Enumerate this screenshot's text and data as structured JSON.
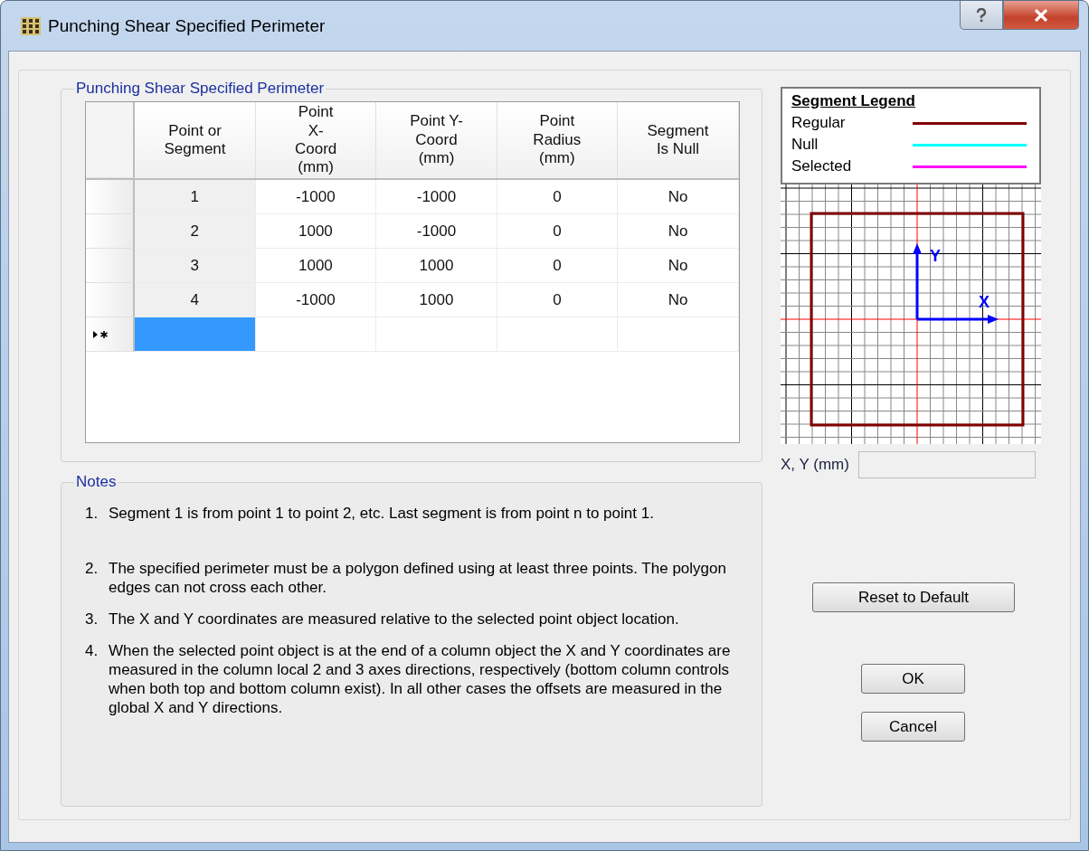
{
  "window": {
    "title": "Punching Shear Specified Perimeter"
  },
  "perimeter_group": {
    "title": "Punching Shear Specified Perimeter"
  },
  "table": {
    "columns": [
      "Point or Segment",
      "Point X-Coord (mm)",
      "Point Y-Coord (mm)",
      "Point Radius (mm)",
      "Segment Is Null"
    ],
    "rows": [
      {
        "cells": [
          "1",
          "-1000",
          "-1000",
          "0",
          "No"
        ]
      },
      {
        "cells": [
          "2",
          "1000",
          "-1000",
          "0",
          "No"
        ]
      },
      {
        "cells": [
          "3",
          "1000",
          "1000",
          "0",
          "No"
        ]
      },
      {
        "cells": [
          "4",
          "-1000",
          "1000",
          "0",
          "No"
        ]
      }
    ],
    "new_row": {
      "selected": true
    }
  },
  "legend": {
    "title": "Segment Legend",
    "items": [
      {
        "label": "Regular",
        "color": "#800000"
      },
      {
        "label": "Null",
        "color": "#00ffff"
      },
      {
        "label": "Selected",
        "color": "#ff00ff"
      }
    ]
  },
  "plot": {
    "axis_labels": [
      "X",
      "Y"
    ]
  },
  "coordinate_field": {
    "label": "X, Y (mm)"
  },
  "notes": {
    "title": "Notes",
    "items": [
      {
        "number": "1.",
        "text": "Segment 1 is from point 1 to point 2, etc.  Last segment is from point n to point 1."
      },
      {
        "number": "2.",
        "text": "The specified perimeter must be a polygon defined using at least three points. The polygon edges can not cross each other."
      },
      {
        "number": "3.",
        "text": "The X and Y coordinates are measured relative to the selected point object location."
      },
      {
        "number": "4.",
        "text": "When the selected point object is at the end of a column object the X and Y coordinates are measured in the column local 2 and 3 axes directions, respectively (bottom column controls when both top and bottom column exist).  In all other cases the offsets are measured in the global X and Y directions."
      }
    ]
  },
  "buttons": {
    "reset": "Reset to Default",
    "ok": "OK",
    "cancel": "Cancel"
  }
}
